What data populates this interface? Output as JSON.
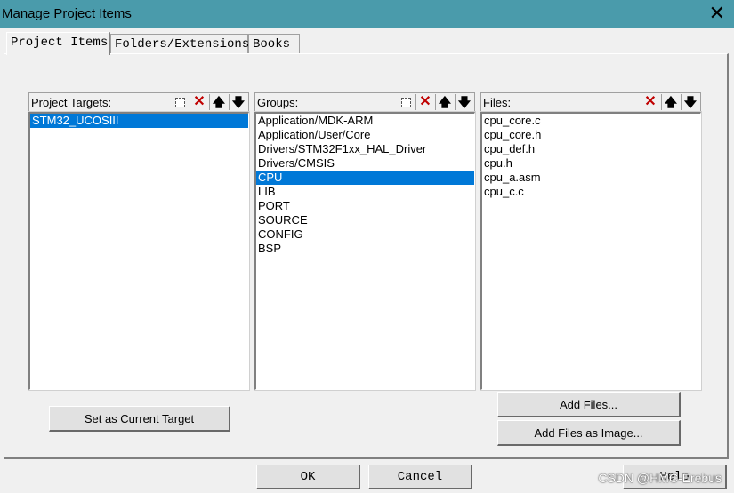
{
  "window": {
    "title": "Manage Project Items"
  },
  "tabs": [
    {
      "label": "Project Items",
      "active": true
    },
    {
      "label": "Folders/Extensions",
      "active": false
    },
    {
      "label": "Books",
      "active": false
    }
  ],
  "targets": {
    "label": "Project Targets:",
    "items": [
      "STM32_UCOSIII"
    ],
    "selected": 0
  },
  "groups": {
    "label": "Groups:",
    "items": [
      "Application/MDK-ARM",
      "Application/User/Core",
      "Drivers/STM32F1xx_HAL_Driver",
      "Drivers/CMSIS",
      "CPU",
      "LIB",
      "PORT",
      "SOURCE",
      "CONFIG",
      "BSP"
    ],
    "selected": 4
  },
  "files": {
    "label": "Files:",
    "items": [
      "cpu_core.c",
      "cpu_core.h",
      "cpu_def.h",
      "cpu.h",
      "cpu_a.asm",
      "cpu_c.c"
    ]
  },
  "buttons": {
    "set_current_target": "Set as Current Target",
    "add_files": "Add Files...",
    "add_files_image": "Add Files as Image...",
    "ok": "OK",
    "cancel": "Cancel",
    "help": "Help"
  },
  "watermark": "CSDN @HMC-Erebus",
  "icons": {
    "new": "new-item-icon",
    "delete": "delete-icon",
    "up": "move-up-icon",
    "down": "move-down-icon",
    "close": "close-icon"
  },
  "colors": {
    "titlebar": "#4a9bab",
    "selection": "#0078d7",
    "delete": "#c00000"
  }
}
